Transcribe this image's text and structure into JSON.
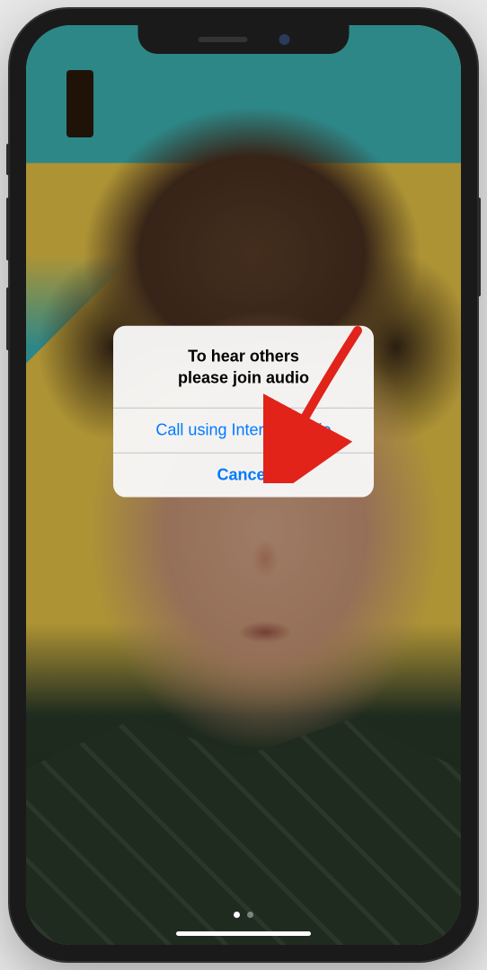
{
  "dialog": {
    "message": "To hear others\nplease join audio",
    "primary_action": "Call using Internet Audio",
    "cancel_action": "Cancel"
  },
  "colors": {
    "ios_blue": "#007aff",
    "dialog_bg": "rgba(248,248,248,0.96)"
  },
  "annotation": {
    "arrow_target": "call-internet-audio-button"
  }
}
